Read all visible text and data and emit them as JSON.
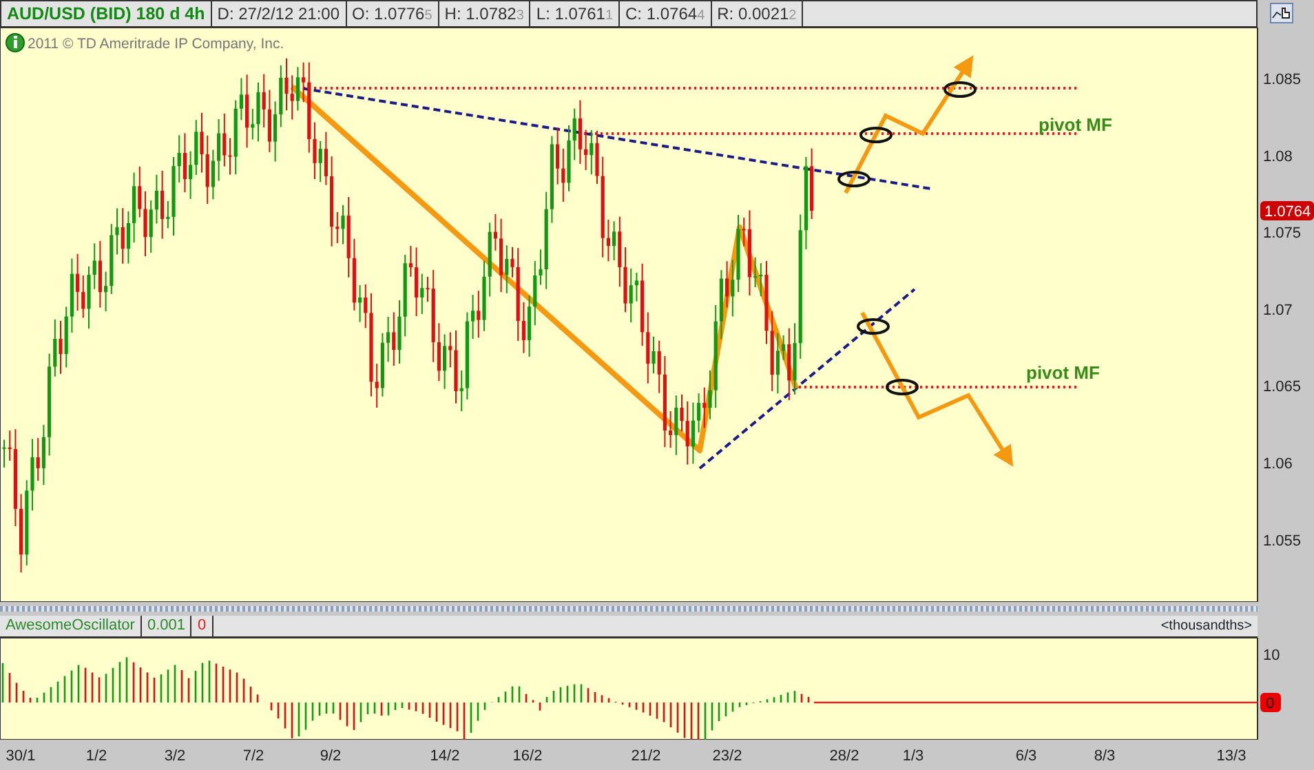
{
  "header": {
    "symbol": "AUD/USD (BID) 180 d 4h",
    "fields": [
      {
        "label": "D: 27/2/12 21:00"
      },
      {
        "label": "O: 1.0776",
        "pip": "5"
      },
      {
        "label": "H: 1.0782",
        "pip": "3"
      },
      {
        "label": "L: 1.0761",
        "pip": "1"
      },
      {
        "label": "C: 1.0764",
        "pip": "4"
      },
      {
        "label": "R: 0.0021",
        "pip": "2"
      }
    ]
  },
  "copyright": "2011 © TD Ameritrade IP Company, Inc.",
  "price_axis": {
    "ticks": [
      "1.085",
      "1.08",
      "1.075",
      "1.07",
      "1.065",
      "1.06",
      "1.055"
    ],
    "current": "1.0764"
  },
  "annotations": [
    "pivot MF",
    "pivot MF"
  ],
  "oscillator": {
    "name": "AwesomeOscillator",
    "step": "0.001",
    "value": "0",
    "unit": "<thousandths>",
    "ticks": [
      "10"
    ],
    "current": "0"
  },
  "dates": [
    "30/1",
    "1/2",
    "3/2",
    "7/2",
    "9/2",
    "14/2",
    "16/2",
    "21/2",
    "23/2",
    "28/2",
    "1/3",
    "6/3",
    "8/3",
    "13/3"
  ]
}
